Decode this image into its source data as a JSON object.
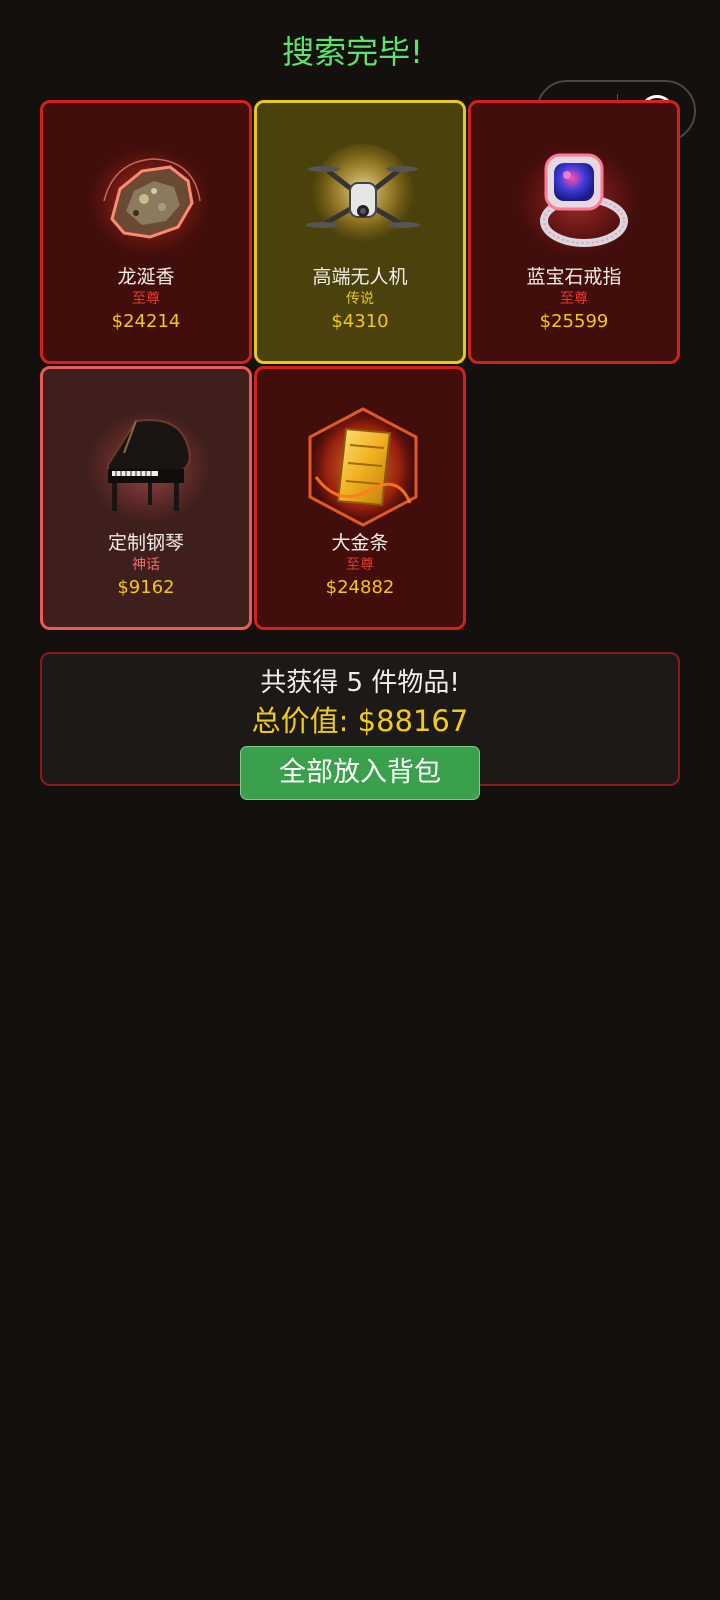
{
  "title": "搜索完毕!",
  "capsule": {
    "more_icon": "more-dots-icon",
    "close_icon": "target-close-icon"
  },
  "items": [
    {
      "name": "龙涎香",
      "rarity": "至尊",
      "price": "$24214",
      "tier": "supreme",
      "icon": "ambergris-icon"
    },
    {
      "name": "高端无人机",
      "rarity": "传说",
      "price": "$4310",
      "tier": "legend",
      "icon": "drone-icon"
    },
    {
      "name": "蓝宝石戒指",
      "rarity": "至尊",
      "price": "$25599",
      "tier": "supreme",
      "icon": "sapphire-ring-icon"
    },
    {
      "name": "定制钢琴",
      "rarity": "神话",
      "price": "$9162",
      "tier": "myth",
      "icon": "grand-piano-icon"
    },
    {
      "name": "大金条",
      "rarity": "至尊",
      "price": "$24882",
      "tier": "supreme",
      "icon": "gold-bar-icon"
    }
  ],
  "summary": {
    "count_text": "共获得 5 件物品!",
    "total_text": "总价值: $88167"
  },
  "button_label": "全部放入背包",
  "colors": {
    "background": "#13100d",
    "title_green": "#5ee36a",
    "supreme_border": "#d3211b",
    "legend_border": "#e8c914",
    "myth_border": "#ea5a5a",
    "price_gold": "#f3c61c",
    "button_green": "#3aa04c"
  }
}
